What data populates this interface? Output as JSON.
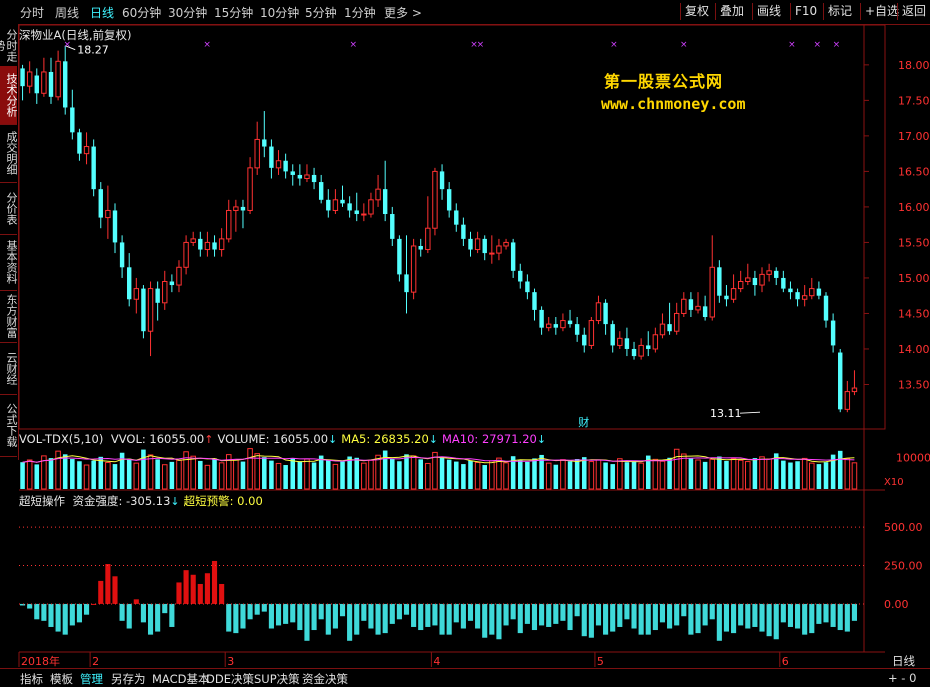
{
  "top_tabs": [
    "分时",
    "周线",
    "日线",
    "60分钟",
    "30分钟",
    "15分钟",
    "10分钟",
    "5分钟",
    "1分钟",
    "更多 >"
  ],
  "top_tab_active": "日线",
  "right_buttons": [
    "复权",
    "叠加",
    "画线",
    "F10",
    "标记",
    "+自选",
    "返回"
  ],
  "left_tabs": [
    "分时走势",
    "技术分析",
    "成交明细",
    "分价表",
    "基本资料",
    "东方财富",
    "云财经",
    "公式下载"
  ],
  "left_tab_active": "技术分析",
  "stock_title": "深物业A(日线,前复权)",
  "watermark": {
    "line1": "第一股票公式网",
    "line2": "www.chnmoney.com"
  },
  "event_marker": "财",
  "vol_header": [
    {
      "text": "VOL-TDX(5,10)",
      "color": "#e6e6e6"
    },
    {
      "text": "VVOL: 16055.00",
      "color": "#e6e6e6"
    },
    {
      "text": "VOLUME: 16055.00",
      "color": "#e6e6e6"
    },
    {
      "text": "MA5: 26835.20",
      "color": "#ffff40"
    },
    {
      "text": "MA10: 27971.20",
      "color": "#ff40ff"
    }
  ],
  "osc_header": [
    {
      "text": "超短操作",
      "color": "#e6e6e6"
    },
    {
      "text": "资金强度: -305.13",
      "color": "#e6e6e6"
    },
    {
      "text": "超短预警: 0.00",
      "color": "#ffff40"
    }
  ],
  "vol_unit": "X10",
  "bottom_tabs": [
    "指标",
    "模板",
    "管理",
    "另存为",
    "MACD基本",
    "DDE决策",
    "SUP决策",
    "资金决策"
  ],
  "bottom_tab_active": "管理",
  "bottom_right": "日线",
  "bottom_right_controls": "+ - 0",
  "chart_data": [
    {
      "type": "candlestick",
      "title": "深物业A(日线,前复权)",
      "y_ticks": [
        13.5,
        14.0,
        14.5,
        15.0,
        15.5,
        16.0,
        16.5,
        17.0,
        17.5,
        18.0
      ],
      "ylim": [
        13.0,
        18.35
      ],
      "x_labels": [
        {
          "index": 0,
          "label": "2018年"
        },
        {
          "index": 10,
          "label": "2"
        },
        {
          "index": 29,
          "label": "3"
        },
        {
          "index": 58,
          "label": "4"
        },
        {
          "index": 81,
          "label": "5"
        },
        {
          "index": 107,
          "label": "6"
        }
      ],
      "high_annotation": {
        "index": 6,
        "value": 18.27
      },
      "low_annotation": {
        "index": 104,
        "value": 13.11
      },
      "event_marker_index": 79,
      "candles": [
        [
          17.95,
          17.7,
          18.0,
          17.5
        ],
        [
          17.7,
          17.9,
          18.05,
          17.6
        ],
        [
          17.85,
          17.6,
          17.95,
          17.45
        ],
        [
          17.6,
          17.9,
          18.1,
          17.55
        ],
        [
          17.9,
          17.55,
          18.1,
          17.45
        ],
        [
          17.55,
          18.05,
          18.2,
          17.5
        ],
        [
          18.05,
          17.4,
          18.27,
          17.3
        ],
        [
          17.4,
          17.05,
          17.65,
          16.95
        ],
        [
          17.05,
          16.75,
          17.1,
          16.65
        ],
        [
          16.75,
          16.85,
          17.05,
          16.6
        ],
        [
          16.85,
          16.25,
          16.95,
          16.15
        ],
        [
          16.25,
          15.85,
          16.35,
          15.7
        ],
        [
          15.85,
          15.95,
          16.3,
          15.55
        ],
        [
          15.95,
          15.5,
          16.05,
          15.35
        ],
        [
          15.5,
          15.15,
          15.6,
          15.0
        ],
        [
          15.15,
          14.7,
          15.35,
          14.6
        ],
        [
          14.7,
          14.85,
          15.0,
          14.5
        ],
        [
          14.85,
          14.25,
          14.9,
          14.15
        ],
        [
          14.25,
          14.85,
          14.95,
          13.9
        ],
        [
          14.85,
          14.65,
          14.95,
          14.4
        ],
        [
          14.65,
          14.95,
          15.1,
          14.55
        ],
        [
          14.95,
          14.9,
          15.05,
          14.8
        ],
        [
          14.9,
          15.15,
          15.25,
          14.8
        ],
        [
          15.15,
          15.5,
          15.6,
          15.05
        ],
        [
          15.5,
          15.55,
          15.65,
          15.45
        ],
        [
          15.55,
          15.4,
          15.65,
          15.3
        ],
        [
          15.4,
          15.5,
          15.65,
          15.3
        ],
        [
          15.5,
          15.4,
          15.6,
          15.3
        ],
        [
          15.4,
          15.55,
          15.7,
          15.3
        ],
        [
          15.55,
          15.95,
          16.1,
          15.5
        ],
        [
          15.95,
          16.0,
          16.1,
          15.65
        ],
        [
          16.0,
          15.95,
          16.1,
          15.7
        ],
        [
          15.95,
          16.55,
          16.7,
          15.9
        ],
        [
          16.55,
          16.95,
          17.2,
          16.45
        ],
        [
          16.95,
          16.85,
          17.35,
          16.7
        ],
        [
          16.85,
          16.55,
          16.95,
          16.4
        ],
        [
          16.55,
          16.65,
          16.8,
          16.45
        ],
        [
          16.65,
          16.5,
          16.75,
          16.4
        ],
        [
          16.5,
          16.45,
          16.6,
          16.3
        ],
        [
          16.45,
          16.4,
          16.6,
          16.3
        ],
        [
          16.4,
          16.45,
          16.6,
          16.35
        ],
        [
          16.45,
          16.35,
          16.55,
          16.25
        ],
        [
          16.35,
          16.1,
          16.45,
          16.05
        ],
        [
          16.1,
          15.95,
          16.25,
          15.85
        ],
        [
          15.95,
          16.1,
          16.25,
          15.9
        ],
        [
          16.1,
          16.05,
          16.3,
          16.0
        ],
        [
          16.05,
          15.95,
          16.15,
          15.85
        ],
        [
          15.95,
          15.9,
          16.2,
          15.8
        ],
        [
          15.9,
          15.9,
          16.05,
          15.8
        ],
        [
          15.9,
          16.1,
          16.2,
          15.85
        ],
        [
          16.1,
          16.25,
          16.45,
          16.0
        ],
        [
          16.25,
          15.9,
          16.65,
          15.8
        ],
        [
          15.9,
          15.55,
          16.0,
          15.45
        ],
        [
          15.55,
          15.05,
          15.6,
          14.95
        ],
        [
          15.05,
          14.8,
          15.6,
          14.5
        ],
        [
          14.8,
          15.45,
          15.55,
          14.7
        ],
        [
          15.45,
          15.4,
          15.55,
          15.3
        ],
        [
          15.4,
          15.7,
          16.15,
          15.35
        ],
        [
          15.7,
          16.5,
          16.55,
          15.6
        ],
        [
          16.5,
          16.25,
          16.6,
          16.1
        ],
        [
          16.25,
          15.95,
          16.35,
          15.85
        ],
        [
          15.95,
          15.75,
          16.05,
          15.65
        ],
        [
          15.75,
          15.55,
          15.85,
          15.45
        ],
        [
          15.55,
          15.4,
          15.65,
          15.3
        ],
        [
          15.4,
          15.55,
          15.65,
          15.35
        ],
        [
          15.55,
          15.35,
          15.6,
          15.25
        ],
        [
          15.35,
          15.35,
          15.6,
          15.2
        ],
        [
          15.35,
          15.45,
          15.55,
          15.25
        ],
        [
          15.45,
          15.5,
          15.55,
          15.4
        ],
        [
          15.5,
          15.1,
          15.55,
          15.0
        ],
        [
          15.1,
          14.95,
          15.2,
          14.85
        ],
        [
          14.95,
          14.8,
          15.05,
          14.7
        ],
        [
          14.8,
          14.55,
          14.85,
          14.4
        ],
        [
          14.55,
          14.3,
          14.6,
          14.2
        ],
        [
          14.3,
          14.35,
          14.45,
          14.25
        ],
        [
          14.35,
          14.3,
          14.45,
          14.2
        ],
        [
          14.3,
          14.4,
          14.5,
          14.25
        ],
        [
          14.4,
          14.35,
          14.55,
          14.3
        ],
        [
          14.35,
          14.2,
          14.45,
          14.1
        ],
        [
          14.2,
          14.05,
          14.3,
          13.95
        ],
        [
          14.05,
          14.4,
          14.45,
          14.0
        ],
        [
          14.4,
          14.65,
          14.75,
          14.35
        ],
        [
          14.65,
          14.35,
          14.7,
          14.2
        ],
        [
          14.35,
          14.05,
          14.4,
          13.95
        ],
        [
          14.05,
          14.15,
          14.25,
          14.0
        ],
        [
          14.15,
          14.0,
          14.3,
          13.9
        ],
        [
          14.0,
          13.9,
          14.1,
          13.85
        ],
        [
          13.9,
          14.05,
          14.15,
          13.85
        ],
        [
          14.05,
          14.0,
          14.25,
          13.9
        ],
        [
          14.0,
          14.2,
          14.3,
          13.95
        ],
        [
          14.2,
          14.35,
          14.5,
          14.15
        ],
        [
          14.35,
          14.25,
          14.65,
          14.2
        ],
        [
          14.25,
          14.5,
          14.65,
          14.2
        ],
        [
          14.5,
          14.7,
          14.8,
          14.45
        ],
        [
          14.7,
          14.55,
          14.8,
          14.45
        ],
        [
          14.55,
          14.6,
          14.8,
          14.5
        ],
        [
          14.6,
          14.45,
          14.75,
          14.4
        ],
        [
          14.45,
          15.15,
          15.6,
          14.4
        ],
        [
          15.15,
          14.75,
          15.25,
          14.65
        ],
        [
          14.75,
          14.7,
          14.9,
          14.6
        ],
        [
          14.7,
          14.85,
          15.05,
          14.65
        ],
        [
          14.85,
          14.95,
          15.1,
          14.8
        ],
        [
          14.95,
          15.0,
          15.2,
          14.9
        ],
        [
          15.0,
          14.9,
          15.1,
          14.75
        ],
        [
          14.9,
          15.05,
          15.15,
          14.8
        ],
        [
          15.05,
          15.1,
          15.2,
          14.95
        ],
        [
          15.1,
          15.0,
          15.15,
          14.9
        ],
        [
          15.0,
          14.85,
          15.1,
          14.8
        ],
        [
          14.85,
          14.8,
          14.95,
          14.7
        ]
      ],
      "candles_tail": [
        [
          14.8,
          14.7,
          14.85,
          14.6
        ],
        [
          14.7,
          14.75,
          14.9,
          14.6
        ],
        [
          14.75,
          14.85,
          15.0,
          14.7
        ],
        [
          14.85,
          14.75,
          14.95,
          14.7
        ],
        [
          14.75,
          14.4,
          14.8,
          14.3
        ],
        [
          14.4,
          14.05,
          14.5,
          13.95
        ],
        [
          13.95,
          13.15,
          14.0,
          13.11
        ],
        [
          13.15,
          13.4,
          13.55,
          13.11
        ],
        [
          13.4,
          13.45,
          13.7,
          13.35
        ]
      ]
    },
    {
      "type": "bar",
      "title": "VOL-TDX(5,10)",
      "y_ticks": [
        10000
      ],
      "ylim": [
        0,
        13000
      ],
      "volume": [
        8500,
        9200,
        7800,
        10500,
        9800,
        12000,
        11000,
        9500,
        8800,
        7600,
        9000,
        10200,
        8400,
        7900,
        11500,
        9600,
        8200,
        12500,
        10800,
        9400,
        7700,
        8600,
        9100,
        11800,
        10400,
        8900,
        7500,
        9700,
        8300,
        10900,
        9300,
        8700,
        12800,
        11200,
        10100,
        9000,
        8100,
        7600,
        9800,
        8800,
        9500,
        8400,
        10600,
        9200,
        7800,
        8700,
        10300,
        9900,
        8200,
        9100,
        10700,
        12200,
        9600,
        8800,
        11000,
        10500,
        9400,
        8100,
        11600,
        10200,
        9300,
        8700,
        7900,
        9000,
        8400,
        7600,
        8900,
        9800,
        8300,
        10400,
        9100,
        8600,
        9700,
        10800,
        8200,
        7700,
        9300,
        8800,
        9500,
        10100,
        8700,
        9200,
        8400,
        7900,
        9600,
        8500,
        9000,
        8200,
        10600,
        9400,
        8800,
        9900,
        12600,
        11100,
        9700,
        9200,
        8600,
        9400,
        10300,
        8900,
        9600,
        9100,
        8700,
        9800,
        10200,
        9500,
        11300,
        9000,
        8400,
        8800,
        9700,
        8200,
        7900,
        8500,
        10900,
        12100,
        9600,
        8300
      ]
    },
    {
      "type": "bar",
      "title": "超短操作",
      "y_ticks": [
        0.0,
        250.0,
        500.0
      ],
      "ylim": [
        -300,
        690
      ],
      "values": [
        -10,
        -30,
        -100,
        -110,
        -150,
        -180,
        -200,
        -140,
        -120,
        -70,
        0,
        150,
        260,
        180,
        -110,
        -160,
        30,
        -120,
        -200,
        -180,
        -60,
        -150,
        140,
        220,
        190,
        130,
        200,
        280,
        130,
        -180,
        -190,
        -160,
        -100,
        -70,
        -50,
        -160,
        -140,
        -130,
        -120,
        -170,
        -240,
        -170,
        -100,
        -200,
        -160,
        -80,
        -240,
        -200,
        -110,
        -160,
        -200,
        -190,
        -130,
        -100,
        -70,
        -150,
        -170,
        -150,
        -140,
        -200,
        -200,
        -120,
        -160,
        -110,
        -160,
        -220,
        -200,
        -230,
        -140,
        -100,
        -190,
        -130,
        -170,
        -140,
        -150,
        -130,
        -110,
        -170,
        -80,
        -210,
        -220,
        -140,
        -200,
        -180,
        -150,
        -100,
        -160,
        -200,
        -200,
        -170,
        -120,
        -160,
        -140,
        -80,
        -200,
        -190,
        -140,
        -100,
        -240,
        -180,
        -190,
        -140,
        -160,
        -150,
        -180,
        -210,
        -230,
        -120,
        -150,
        -160,
        -200,
        -190,
        -130,
        -120,
        -150,
        -170,
        -180,
        -110
      ]
    }
  ]
}
